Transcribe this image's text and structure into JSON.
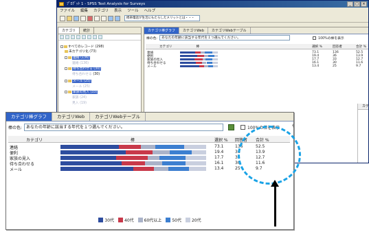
{
  "app": {
    "title": "ﾌﾟﾛｸﾞｯﾄ 1 - SPSS Text Analysis for Surveys",
    "menu": [
      "ファイル",
      "編集",
      "カテゴリ",
      "表示",
      "ツール",
      "ヘルプ"
    ],
    "search_text": "携帯電話が生活にもたらしたメリットとは・・・"
  },
  "tree": {
    "tabs": [
      "カテゴリ",
      "統計"
    ],
    "nodes": [
      {
        "label": "すべてのレコード (298)",
        "style": "normal"
      },
      {
        "label": "未カテゴリ化 (73)",
        "style": "normal"
      },
      {
        "label": "連絡 (136)",
        "style": "hl"
      },
      {
        "label": "連絡 (136)",
        "style": "dim"
      },
      {
        "label": "待ち合わせる (30)",
        "style": "hl"
      },
      {
        "label": "待ち合わせる",
        "style": "dim"
      },
      {
        "label": "(30)",
        "style": "normal"
      },
      {
        "label": "メール (25)",
        "style": "hl"
      },
      {
        "label": "メール (25)",
        "style": "dim"
      },
      {
        "label": "家族の見入 (33)",
        "style": "hl"
      },
      {
        "label": "家族 (24)",
        "style": "dim"
      },
      {
        "label": "見入 (19)",
        "style": "dim"
      }
    ]
  },
  "panel": {
    "tabs": [
      "カテゴリ棒グラフ",
      "カテゴリWeb",
      "カテゴリWebテーブル"
    ],
    "variable_label": "棒の色:",
    "variable_value": "あなたの年齢に該当する年代を１つ選んでください。",
    "checkbox_label": "100%の棒を表示",
    "columns": {
      "category": "カテゴリ",
      "bar": "棒",
      "pct": "選択 %",
      "count": "回答者",
      "total": "合計 %"
    },
    "rows": [
      {
        "category": "連絡",
        "pct": "73.1",
        "count": "136",
        "total": "52.5",
        "segments": [
          40,
          15,
          10,
          20,
          15
        ]
      },
      {
        "category": "便利",
        "pct": "19.4",
        "count": "36",
        "total": "13.9",
        "segments": [
          45,
          18,
          12,
          15,
          10
        ]
      },
      {
        "category": "家族の見入",
        "pct": "17.7",
        "count": "33",
        "total": "12.7",
        "segments": [
          38,
          22,
          8,
          18,
          14
        ]
      },
      {
        "category": "待ち合わせる",
        "pct": "16.1",
        "count": "30",
        "total": "11.6",
        "segments": [
          42,
          16,
          12,
          16,
          14
        ]
      },
      {
        "category": "メール",
        "pct": "13.4",
        "count": "25",
        "total": "9.7",
        "segments": [
          50,
          14,
          10,
          14,
          12
        ]
      }
    ],
    "legend": [
      {
        "label": "30代",
        "color": "#2e4d9f"
      },
      {
        "label": "40代",
        "color": "#c8394a"
      },
      {
        "label": "60代以上",
        "color": "#aab3c9"
      },
      {
        "label": "50代",
        "color": "#3d7fd0"
      },
      {
        "label": "20代",
        "color": "#c9cfdf"
      }
    ]
  },
  "bg_side": {
    "header": "カテゴリ",
    "items": [
      "連絡",
      "便利",
      "連絡",
      "便利",
      "家族の見入",
      "待ち合わせ",
      "メール"
    ]
  },
  "bg_partial_text": "代"
}
